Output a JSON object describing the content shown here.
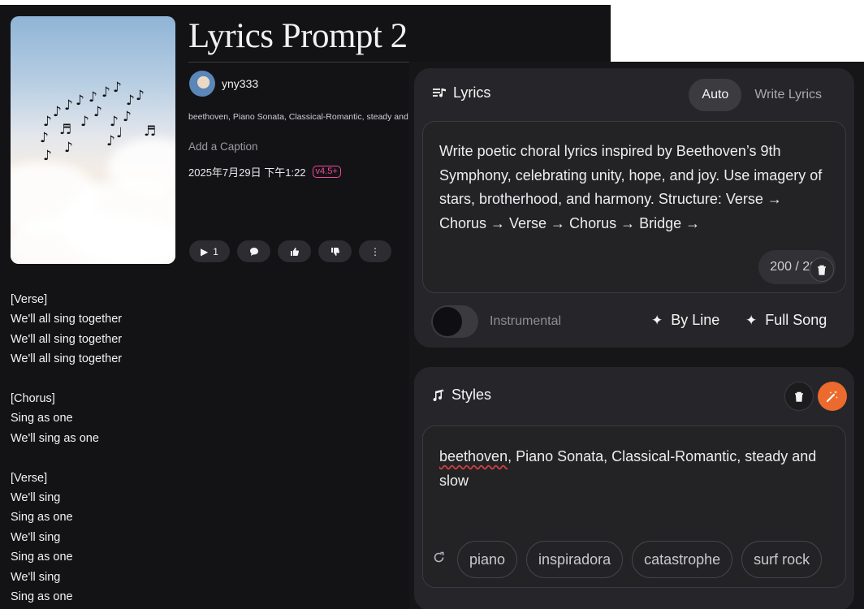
{
  "song": {
    "title": "Lyrics Prompt 2",
    "username": "yny333",
    "style_tags": "beethoven, Piano Sonata, Classical-Romantic, steady and slow",
    "caption_placeholder": "Add a Caption",
    "created": "2025年7月29日 下午1:22",
    "version": "v4.5+",
    "play_count": "1",
    "lyrics": "[Verse]\nWe'll all sing together\nWe'll all sing together\nWe'll all sing together\n\n[Chorus]\nSing as one\nWe'll sing as one\n\n[Verse]\nWe'll sing\nSing as one\nWe'll sing\nSing as one\nWe'll sing\nSing as one"
  },
  "icons": {
    "play": "play-icon",
    "comment": "comment-icon",
    "like": "thumbs-up-icon",
    "dislike": "thumbs-down-icon",
    "more": "more-vertical-icon",
    "lyrics": "lyrics-note-icon",
    "styles": "styles-note-icon",
    "trash": "trash-icon",
    "magic": "magic-wand-icon",
    "shuffle": "shuffle-icon"
  },
  "lyrics_panel": {
    "heading": "Lyrics",
    "modes": [
      "Auto",
      "Write Lyrics"
    ],
    "active_mode": "Auto",
    "prompt": "Write poetic choral lyrics inspired by Beethoven’s 9th Symphony, celebrating unity, hope, and joy. Use imagery of stars, brotherhood, and harmony. Structure: Verse → Chorus → Verse → Chorus → Bridge →",
    "char_count": "200 / 200",
    "instrumental_label": "Instrumental",
    "instrumental_on": false,
    "by_line": "By Line",
    "full_song": "Full Song"
  },
  "styles_panel": {
    "heading": "Styles",
    "misspelled_word": "beethoven",
    "value_rest": ", Piano Sonata, Classical-Romantic, steady and slow",
    "suggestions": [
      "piano",
      "inspiradora",
      "catastrophe",
      "surf rock"
    ]
  },
  "colors": {
    "accent_pink": "#f0489a",
    "magic_orange": "#ec6a2d",
    "panel_bg": "#26262a"
  }
}
